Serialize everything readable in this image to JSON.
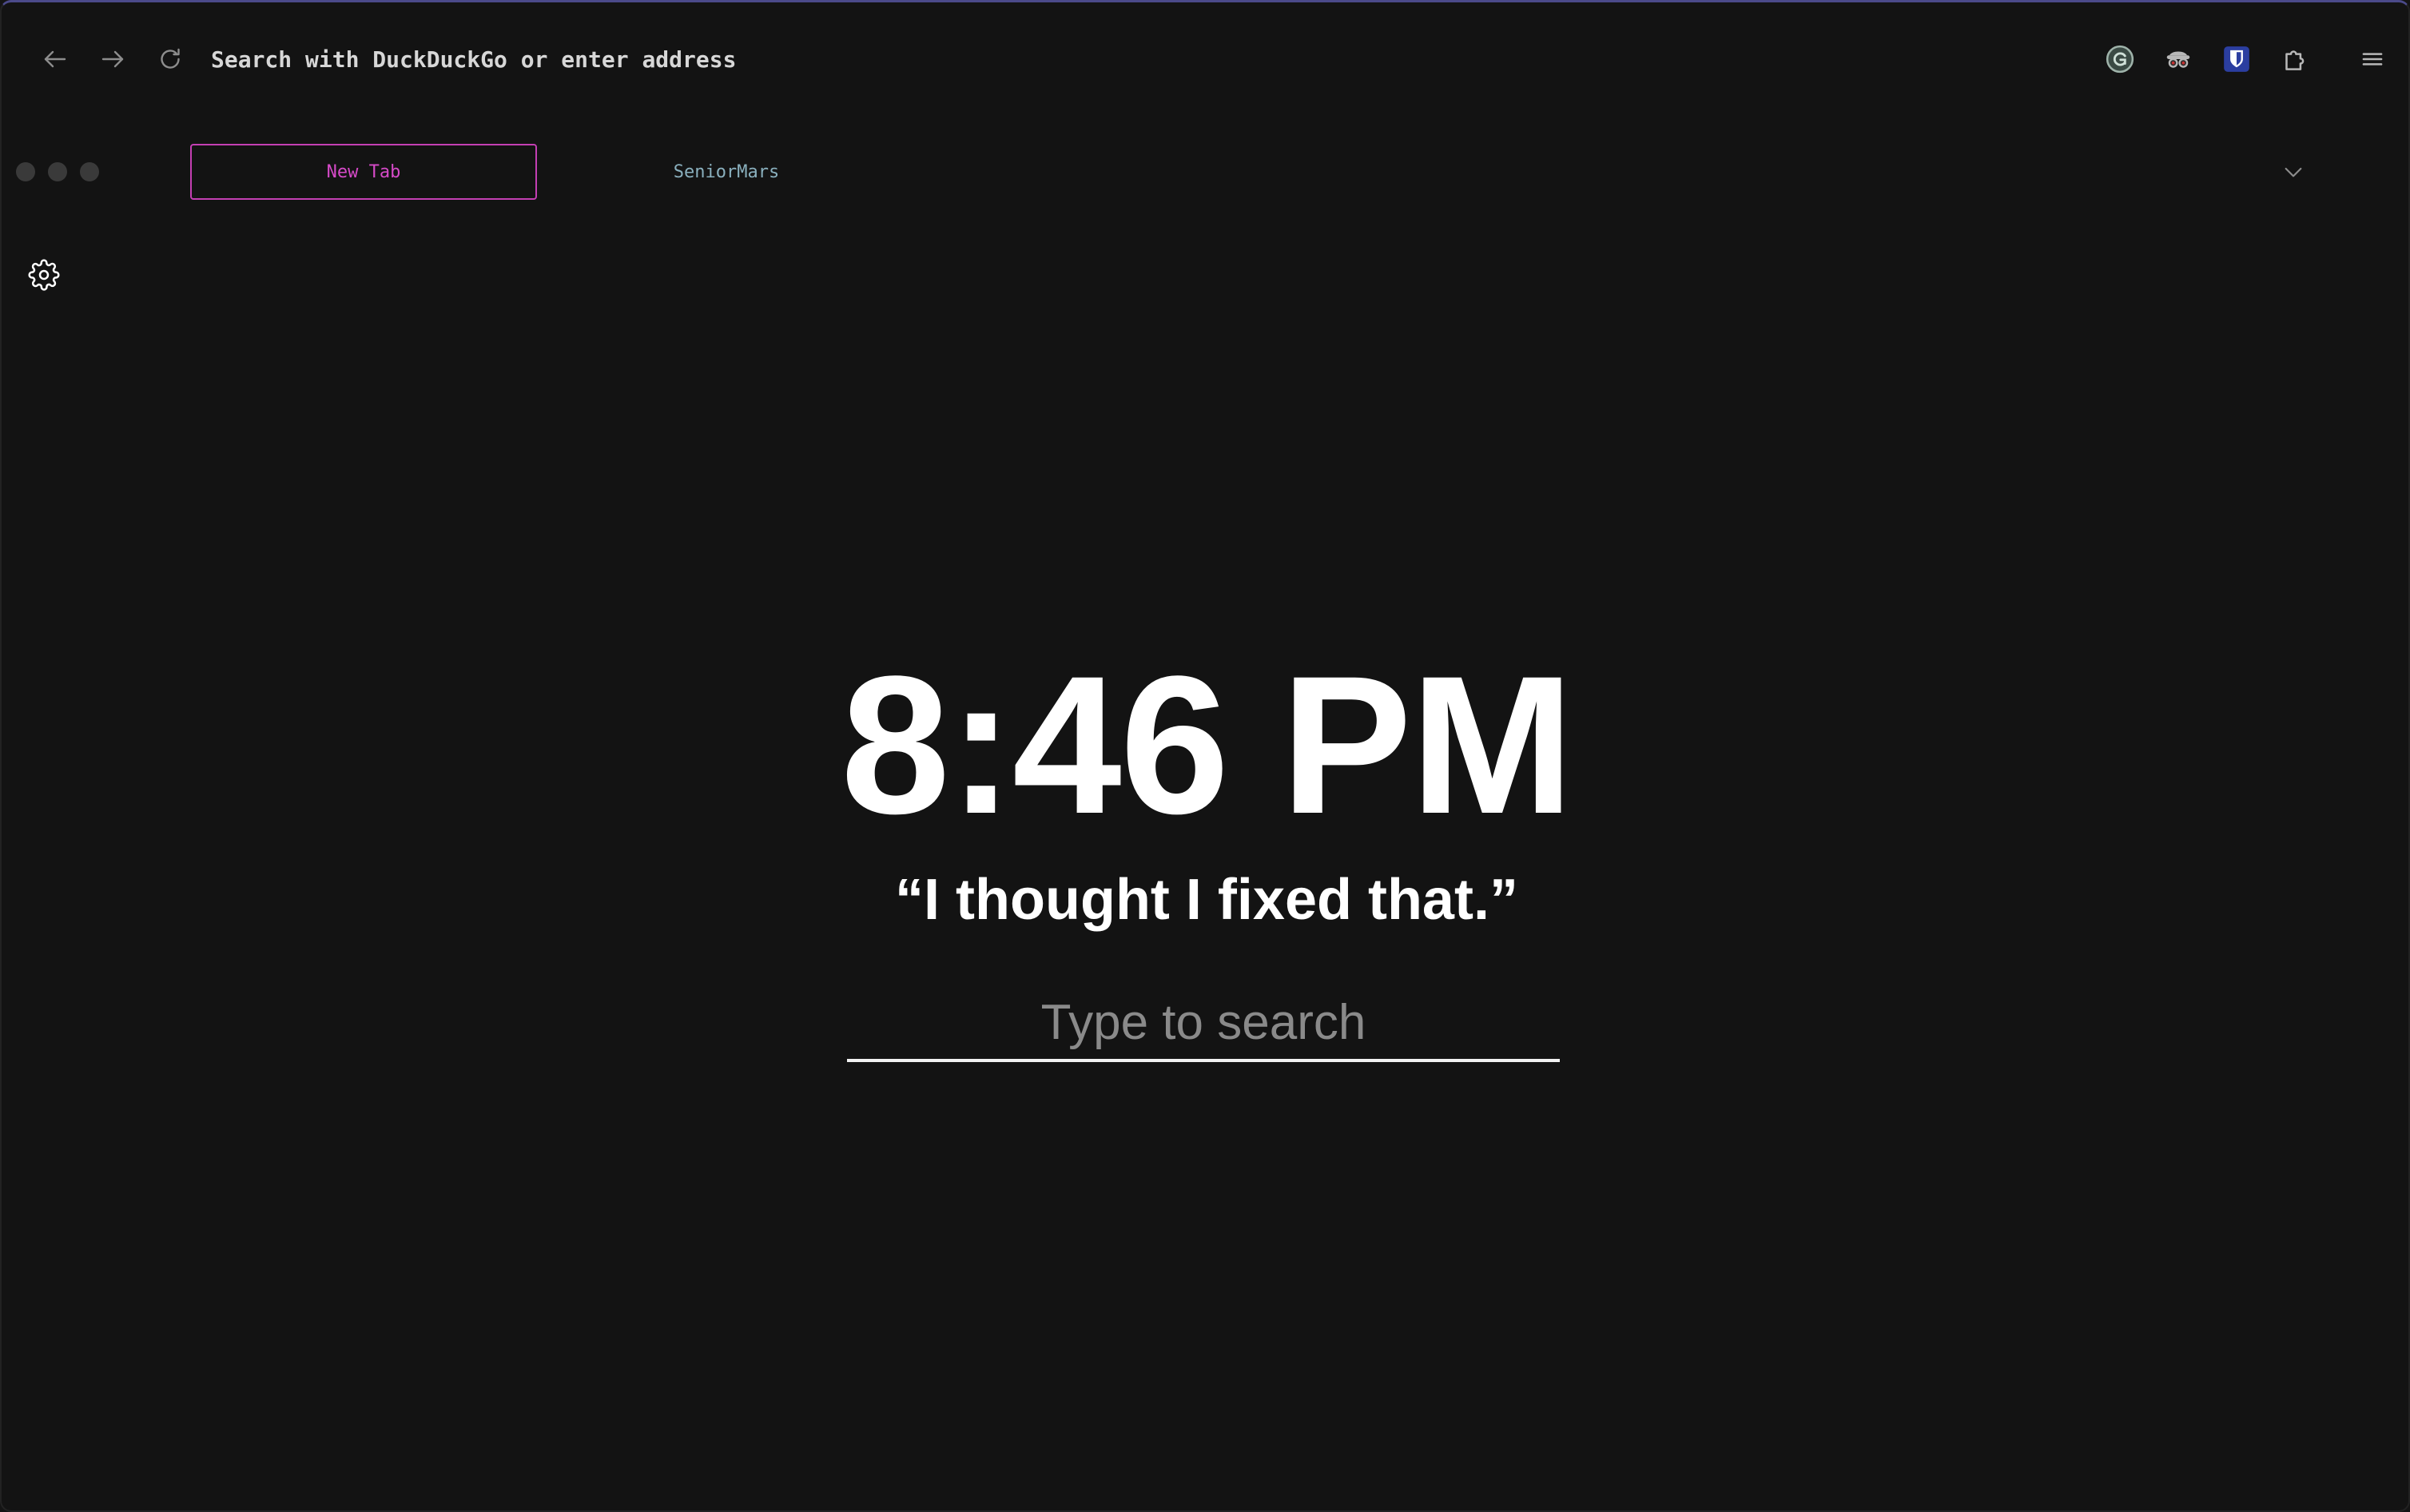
{
  "browser": {
    "address_bar": {
      "placeholder": "Search with DuckDuckGo or enter address"
    },
    "nav_icons": [
      "back-arrow-icon",
      "forward-arrow-icon",
      "reload-icon"
    ],
    "extension_icons": [
      "grammarly-icon",
      "privacy-mask-icon",
      "bitwarden-shield-icon",
      "extensions-puzzle-icon",
      "menu-icon"
    ],
    "tabs": [
      {
        "label": "New Tab",
        "active": true
      },
      {
        "label": "SeniorMars",
        "active": false
      }
    ],
    "colors": {
      "background": "#131313",
      "active_tab_accent": "#c43fb3",
      "inactive_tab_text": "#8ab0be",
      "frame_top": "#4b4a8a"
    }
  },
  "newtab": {
    "time": "8:46 PM",
    "quote": "“I thought I fixed that.”",
    "search_placeholder": "Type to search",
    "settings_icon": "gear-icon"
  }
}
